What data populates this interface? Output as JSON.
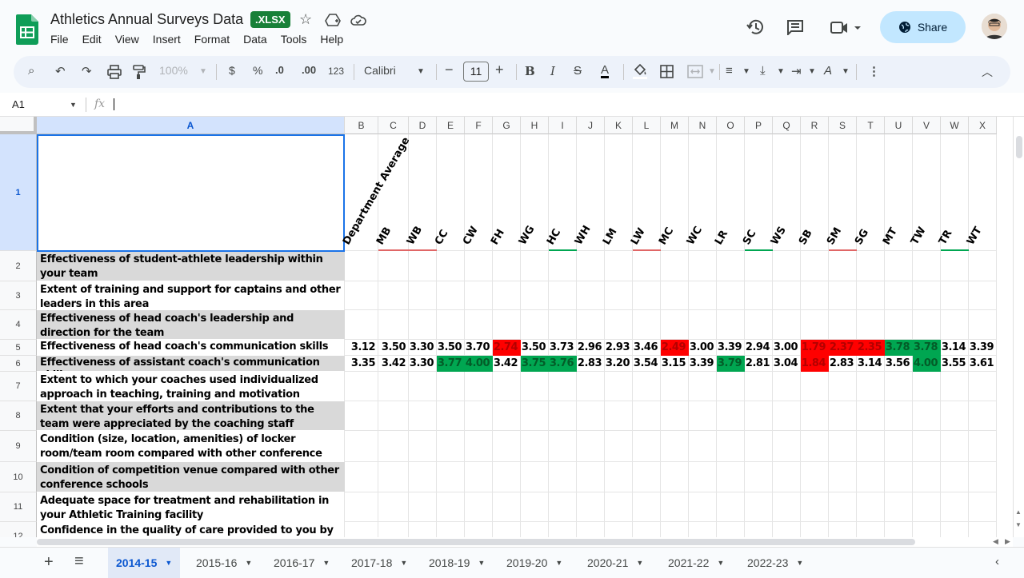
{
  "app": {
    "title": "Athletics Annual Surveys Data",
    "badge": ".XLSX",
    "share_label": "Share",
    "menu": [
      "File",
      "Edit",
      "View",
      "Insert",
      "Format",
      "Data",
      "Tools",
      "Help"
    ]
  },
  "toolbar": {
    "zoom": "100%",
    "currency": "$",
    "percent": "%",
    "dec_minus": ".0",
    "dec_plus": ".00",
    "num_format": "123",
    "font": "Calibri",
    "font_size": "11"
  },
  "formula_bar": {
    "cell_ref": "A1",
    "fx": "fx"
  },
  "columns": [
    "A",
    "B",
    "C",
    "D",
    "E",
    "F",
    "G",
    "H",
    "I",
    "J",
    "K",
    "L",
    "M",
    "N",
    "O",
    "P",
    "Q",
    "R",
    "S",
    "T",
    "U",
    "V",
    "W",
    "X"
  ],
  "header_labels": [
    "Department Average",
    "MB",
    "WB",
    "CC",
    "CW",
    "FH",
    "WG",
    "HC",
    "WH",
    "LM",
    "LW",
    "MC",
    "WC",
    "LR",
    "SC",
    "WS",
    "SB",
    "SM",
    "SG",
    "MT",
    "TW",
    "TR",
    "WT"
  ],
  "rows": [
    {
      "num": "1",
      "label": ""
    },
    {
      "num": "2",
      "label": "Effectiveness of student-athlete leadership within your team"
    },
    {
      "num": "3",
      "label": "Extent of training and support for captains and other leaders in this area"
    },
    {
      "num": "4",
      "label": "Effectiveness of head coach's leadership and direction for the team"
    },
    {
      "num": "5",
      "label": "Effectiveness of head coach's communication skills"
    },
    {
      "num": "6",
      "label": "Effectiveness of assistant coach's communication skills"
    },
    {
      "num": "7",
      "label": "Extent to which your coaches used individualized approach in teaching, training and motivation"
    },
    {
      "num": "8",
      "label": "Extent that your efforts and contributions to the team were appreciated by the coaching staff"
    },
    {
      "num": "9",
      "label": "Condition (size, location, amenities) of locker room/team room compared with other conference schools"
    },
    {
      "num": "10",
      "label": "Condition of competition venue compared with other conference schools"
    },
    {
      "num": "11",
      "label": "Adequate space for treatment and rehabilitation in your Athletic Training facility"
    },
    {
      "num": "12",
      "label": "Confidence in the quality of care provided to you by your"
    }
  ],
  "row5_values": [
    "3.12",
    "3.50",
    "3.30",
    "3.50",
    "3.70",
    "2.74",
    "3.50",
    "3.73",
    "2.96",
    "2.93",
    "3.46",
    "2.49",
    "3.00",
    "3.39",
    "2.94",
    "3.00",
    "1.79",
    "2.37",
    "2.35",
    "3.78",
    "3.78",
    "3.14",
    "3.39"
  ],
  "row5_colors": [
    "",
    "",
    "",
    "",
    "",
    "red",
    "",
    "",
    "",
    "",
    "",
    "red",
    "",
    "",
    "",
    "",
    "red",
    "red",
    "red",
    "green",
    "green",
    "",
    ""
  ],
  "row6_values": [
    "3.35",
    "3.42",
    "3.30",
    "3.77",
    "4.00",
    "3.42",
    "3.75",
    "3.76",
    "2.83",
    "3.20",
    "3.54",
    "3.15",
    "3.39",
    "3.79",
    "2.81",
    "3.04",
    "1.84",
    "2.83",
    "3.14",
    "3.56",
    "4.00",
    "3.55",
    "3.61"
  ],
  "row6_colors": [
    "",
    "",
    "",
    "green",
    "green",
    "",
    "green",
    "green",
    "",
    "",
    "",
    "",
    "",
    "green",
    "",
    "",
    "red",
    "",
    "",
    "",
    "green",
    "",
    ""
  ],
  "sheets": [
    "2014-15",
    "2015-16",
    "2016-17",
    "2017-18",
    "2018-19",
    "2019-20",
    "2020-21",
    "2021-22",
    "2022-23"
  ],
  "active_sheet": "2014-15"
}
